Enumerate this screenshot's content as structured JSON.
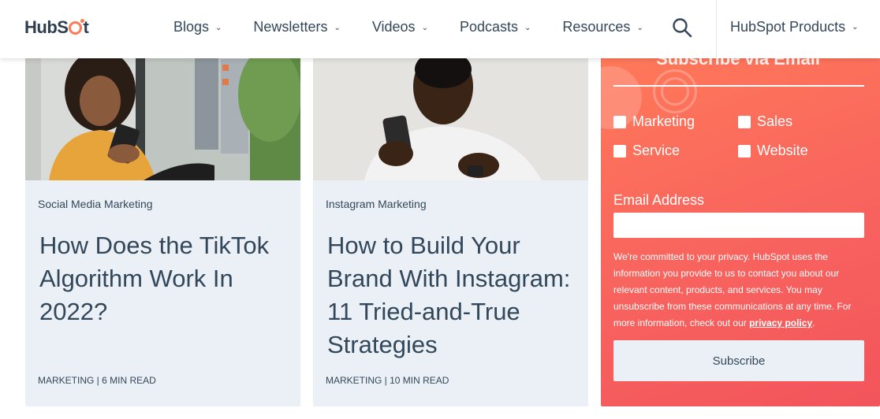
{
  "header": {
    "logo": {
      "part1": "HubS",
      "part2": "t"
    },
    "nav": [
      {
        "label": "Blogs"
      },
      {
        "label": "Newsletters"
      },
      {
        "label": "Videos"
      },
      {
        "label": "Podcasts"
      },
      {
        "label": "Resources"
      }
    ],
    "products_label": "HubSpot Products"
  },
  "cards": [
    {
      "category": "Social Media Marketing",
      "title": "How Does the TikTok Algorithm Work In 2022?",
      "meta": "MARKETING | 6 MIN READ"
    },
    {
      "category": "Instagram Marketing",
      "title": "How to Build Your Brand With Instagram: 11 Tried-and-True Strategies",
      "meta": "MARKETING | 10 MIN READ"
    }
  ],
  "subscribe": {
    "title": "Subscribe via Email",
    "options": [
      "Marketing",
      "Sales",
      "Service",
      "Website"
    ],
    "email_label": "Email Address",
    "privacy_text": "We're committed to your privacy. HubSpot uses the information you provide to us to contact you about our relevant content, products, and services. You may unsubscribe from these communications at any time. For more information, check out our ",
    "privacy_link": "privacy policy",
    "privacy_end": ".",
    "button_label": "Subscribe"
  },
  "colors": {
    "brand_orange": "#ff7a59",
    "panel_coral": "#f2545b",
    "card_bg": "#eaf0f6",
    "text_dark": "#33475b"
  }
}
